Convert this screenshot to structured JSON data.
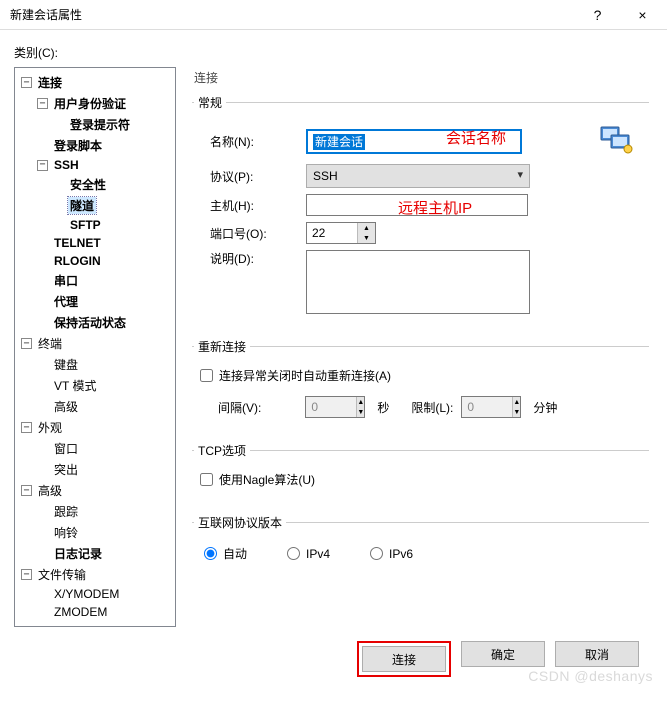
{
  "window": {
    "title": "新建会话属性",
    "help_symbol": "?",
    "close_symbol": "×"
  },
  "category_label": "类别(C):",
  "tree": {
    "connection": "连接",
    "auth": "用户身份验证",
    "login_prompt": "登录提示符",
    "login_script": "登录脚本",
    "ssh": "SSH",
    "security": "安全性",
    "tunnel": "隧道",
    "sftp": "SFTP",
    "telnet": "TELNET",
    "rlogin": "RLOGIN",
    "serial": "串口",
    "proxy": "代理",
    "keep_alive": "保持活动状态",
    "terminal": "终端",
    "keyboard": "键盘",
    "vt_mode": "VT 模式",
    "advanced_t": "高级",
    "appearance": "外观",
    "window": "窗口",
    "highlight": "突出",
    "advanced": "高级",
    "trace": "跟踪",
    "bell": "响铃",
    "logging": "日志记录",
    "file_transfer": "文件传输",
    "xymodem": "X/YMODEM",
    "zmodem": "ZMODEM"
  },
  "panel": {
    "title": "连接",
    "general": {
      "legend": "常规",
      "name_label": "名称(N):",
      "name_value": "新建会话",
      "name_annotation": "会话名称",
      "protocol_label": "协议(P):",
      "protocol_value": "SSH",
      "host_label": "主机(H):",
      "host_value": "",
      "host_annotation": "远程主机IP",
      "port_label": "端口号(O):",
      "port_value": "22",
      "desc_label": "说明(D):",
      "desc_value": ""
    },
    "reconnect": {
      "legend": "重新连接",
      "check_label": "连接异常关闭时自动重新连接(A)",
      "interval_label": "间隔(V):",
      "interval_value": "0",
      "interval_unit": "秒",
      "limit_label": "限制(L):",
      "limit_value": "0",
      "limit_unit": "分钟"
    },
    "tcp": {
      "legend": "TCP选项",
      "nagle_label": "使用Nagle算法(U)"
    },
    "ip": {
      "legend": "互联网协议版本",
      "auto": "自动",
      "ipv4": "IPv4",
      "ipv6": "IPv6"
    }
  },
  "buttons": {
    "connect": "连接",
    "ok": "确定",
    "cancel": "取消"
  },
  "watermark": "CSDN @deshanys"
}
